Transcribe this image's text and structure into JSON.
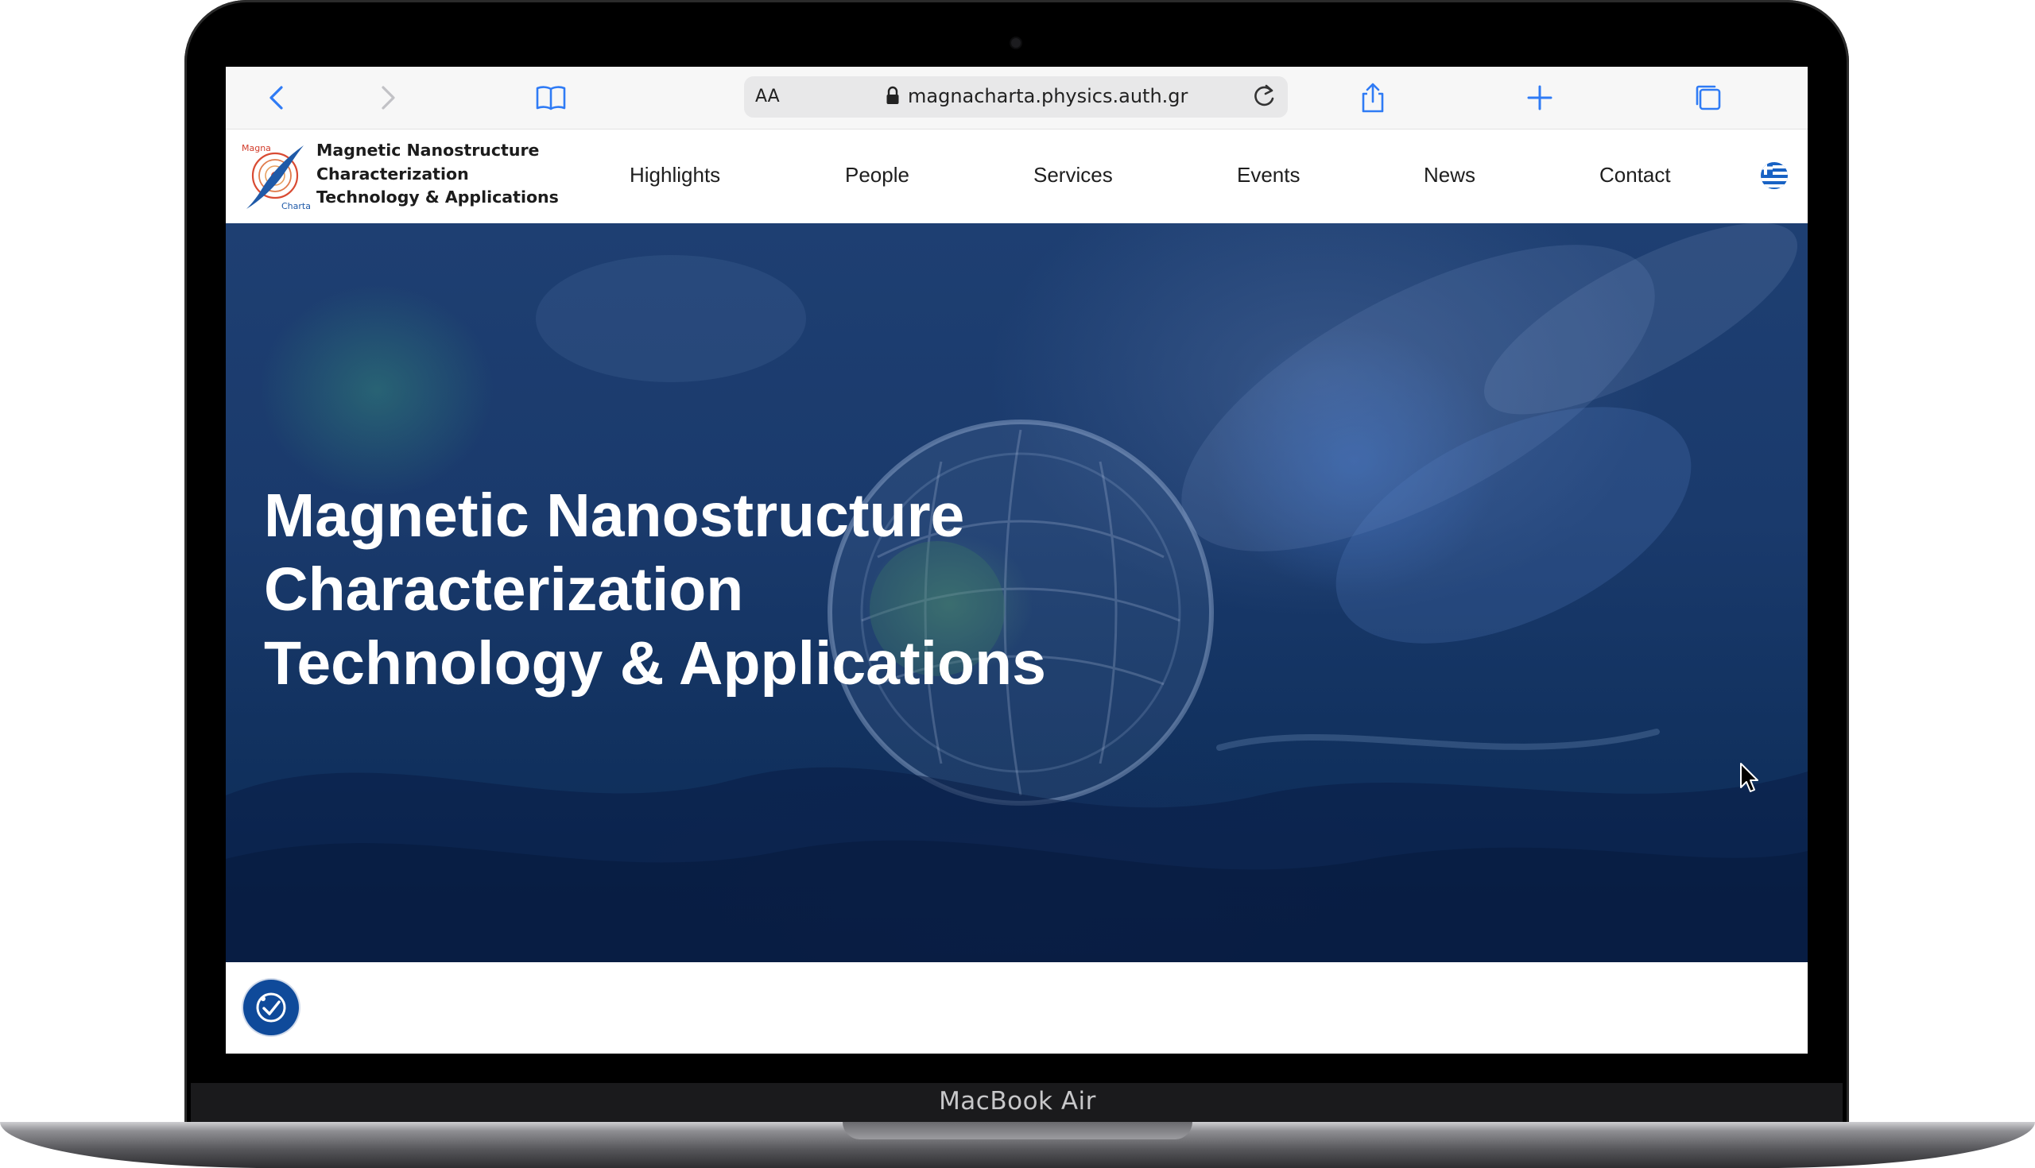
{
  "device": {
    "label": "MacBook Air"
  },
  "browser": {
    "text_size_label": "AA",
    "url": "magnacharta.physics.auth.gr",
    "icons": [
      "back-icon",
      "forward-icon",
      "bookmarks-icon",
      "lock-icon",
      "reload-icon",
      "share-icon",
      "new-tab-icon",
      "tabs-icon"
    ]
  },
  "site": {
    "logo": {
      "mark_top": "Magna",
      "mark_bottom": "Charta",
      "lines": [
        "Magnetic Nanostructure",
        "Characterization",
        "Technology & Applications"
      ]
    },
    "nav": [
      "Highlights",
      "People",
      "Services",
      "Events",
      "News",
      "Contact"
    ],
    "language_icon": "greek-flag-icon",
    "hero": {
      "lines": [
        "Magnetic Nanostructure",
        "Characterization",
        "Technology & Applications"
      ]
    },
    "accessibility_icon": "accessibility-icon"
  },
  "colors": {
    "hero_overlay": "#1a3a6c",
    "accent": "#0f4a9a",
    "toolbar_tint": "#3b82f6"
  }
}
